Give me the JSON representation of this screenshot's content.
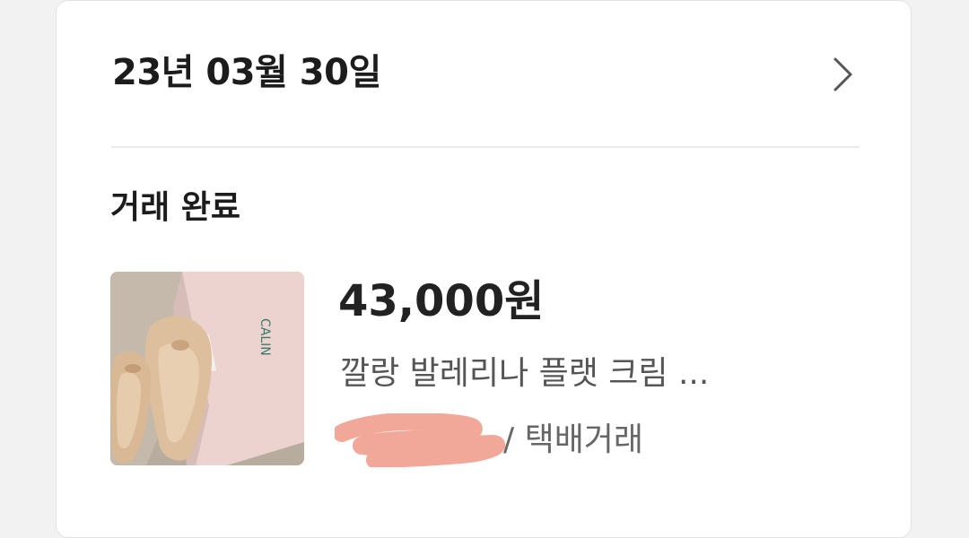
{
  "header": {
    "date": "23년 03월 30일"
  },
  "transaction": {
    "status": "거래 완료",
    "price": "43,000원",
    "item_title": "깔랑 발레리나 플랫 크림 ...",
    "trade_method": "/ 택배거래"
  },
  "thumbnail": {
    "brand_text": "CALIN"
  },
  "icons": {
    "chevron": "chevron-right-icon"
  },
  "colors": {
    "text_primary": "#1c1c1c",
    "text_secondary": "#555555",
    "divider": "#ebebeb",
    "redaction": "#f2a898"
  }
}
